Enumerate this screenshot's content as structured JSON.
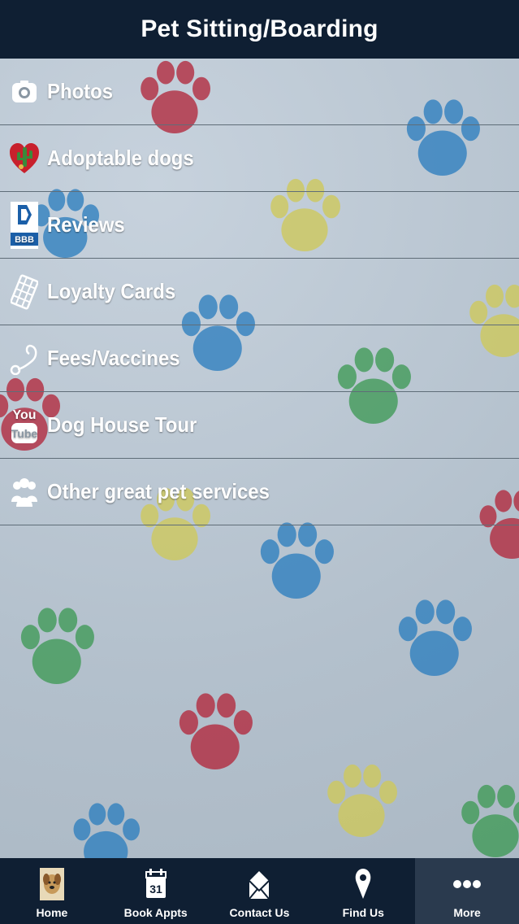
{
  "header": {
    "title": "Pet Sitting/Boarding"
  },
  "menu": {
    "items": [
      {
        "label": "Photos",
        "icon": "camera-icon"
      },
      {
        "label": "Adoptable dogs",
        "icon": "heart-cactus-icon"
      },
      {
        "label": "Reviews",
        "icon": "bbb-icon"
      },
      {
        "label": "Loyalty Cards",
        "icon": "loyalty-card-icon"
      },
      {
        "label": "Fees/Vaccines",
        "icon": "stethoscope-icon"
      },
      {
        "label": "Dog House Tour",
        "icon": "youtube-icon"
      },
      {
        "label": "Other great pet services",
        "icon": "people-icon"
      }
    ],
    "bbb_text": "BBB",
    "youtube_text": {
      "you": "You",
      "tube": "Tube"
    }
  },
  "tabbar": {
    "tabs": [
      {
        "label": "Home",
        "icon": "dog-photo-icon"
      },
      {
        "label": "Book Appts",
        "icon": "calendar-icon",
        "calendar_day": "31"
      },
      {
        "label": "Contact Us",
        "icon": "envelope-icon"
      },
      {
        "label": "Find Us",
        "icon": "map-pin-icon"
      },
      {
        "label": "More",
        "icon": "more-dots-icon",
        "active": true
      }
    ]
  },
  "colors": {
    "header_bg": "#0f1f33",
    "tabbar_bg": "#0f1f33",
    "active_tab_bg": "#2a3a4e",
    "paw_red": "#b2283c",
    "paw_blue": "#2e7fbf",
    "paw_yellow": "#cfc95a",
    "paw_green": "#3f9a56"
  }
}
